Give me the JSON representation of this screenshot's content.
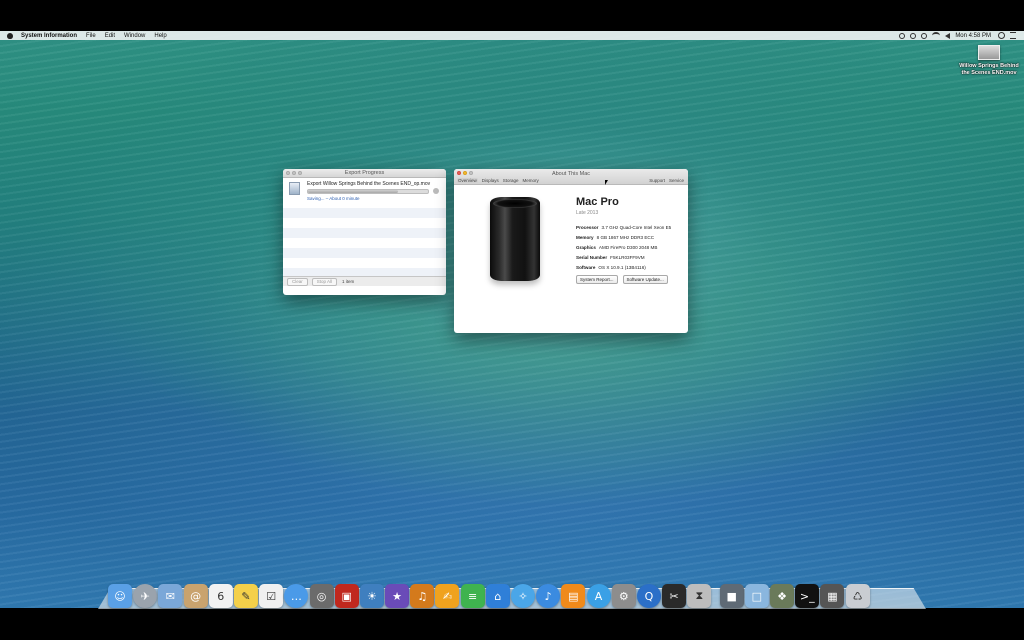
{
  "menubar": {
    "app_name": "System Information",
    "items": [
      "File",
      "Edit",
      "Window",
      "Help"
    ],
    "clock": "Mon 4:58 PM"
  },
  "desktop_file": {
    "label": "Willow Springs Behind the Scenes END.mov"
  },
  "export_window": {
    "title": "Export Progress",
    "job_title": "Export Willow Springs Behind the Scenes END_op.mov",
    "job_status": "Saving... – About 0 minute",
    "progress": 0.75,
    "clear_label": "Clear",
    "stop_label": "Stop All",
    "count": "1 item"
  },
  "about_window": {
    "title": "About This Mac",
    "tabs": [
      "Overview",
      "Displays",
      "Storage",
      "Memory"
    ],
    "right_tabs": [
      "Support",
      "Service"
    ],
    "model": "Mac Pro",
    "year": "Late 2013",
    "specs": [
      {
        "label": "Processor",
        "value": "3.7 GHz Quad-Core Intel Xeon E5"
      },
      {
        "label": "Memory",
        "value": "8 GB 1867 MHz DDR3 ECC"
      },
      {
        "label": "Graphics",
        "value": "AMD FirePro D300 2048 MB"
      },
      {
        "label": "Serial Number",
        "value": "F5KLR03FF9VM"
      },
      {
        "label": "Software",
        "value": "OS X 10.9.1 (13B4116)"
      }
    ],
    "system_report_label": "System Report...",
    "software_update_label": "Software Update..."
  },
  "dock": {
    "icons": [
      {
        "name": "finder-icon",
        "color": "#5aa0e6",
        "glyph": "☺"
      },
      {
        "name": "launchpad-icon",
        "color": "#9aa3ad",
        "glyph": "✈"
      },
      {
        "name": "mail-icon",
        "color": "#7aa7d8",
        "glyph": "✉"
      },
      {
        "name": "contacts-icon",
        "color": "#c9a36e",
        "glyph": "@"
      },
      {
        "name": "calendar-icon",
        "color": "#f2f2f2",
        "glyph": "6"
      },
      {
        "name": "notes-icon",
        "color": "#f4d04a",
        "glyph": "✎"
      },
      {
        "name": "reminders-icon",
        "color": "#f0f0f0",
        "glyph": "☑"
      },
      {
        "name": "messages-icon",
        "color": "#4a9ae8",
        "glyph": "…"
      },
      {
        "name": "facetime-icon",
        "color": "#6b6b6b",
        "glyph": "◎"
      },
      {
        "name": "photo-booth-icon",
        "color": "#c0281e",
        "glyph": "▣"
      },
      {
        "name": "iphoto-icon",
        "color": "#3f7fbf",
        "glyph": "☀"
      },
      {
        "name": "imovie-icon",
        "color": "#6a4bb8",
        "glyph": "★"
      },
      {
        "name": "garageband-icon",
        "color": "#d47a1c",
        "glyph": "♫"
      },
      {
        "name": "pages-icon",
        "color": "#f0a21e",
        "glyph": "✍"
      },
      {
        "name": "numbers-icon",
        "color": "#3fb34f",
        "glyph": "≡"
      },
      {
        "name": "keynote-icon",
        "color": "#2f7fd8",
        "glyph": "⌂"
      },
      {
        "name": "safari-icon",
        "color": "#4aa6e8",
        "glyph": "✧"
      },
      {
        "name": "itunes-icon",
        "color": "#3b8be0",
        "glyph": "♪"
      },
      {
        "name": "ibooks-icon",
        "color": "#f08a1a",
        "glyph": "▤"
      },
      {
        "name": "app-store-icon",
        "color": "#3aa0e6",
        "glyph": "A"
      },
      {
        "name": "system-preferences-icon",
        "color": "#8d8d8d",
        "glyph": "⚙"
      },
      {
        "name": "quicktime-icon",
        "color": "#2b6fc8",
        "glyph": "Q"
      },
      {
        "name": "final-cut-pro-icon",
        "color": "#2a2a2a",
        "glyph": "✂"
      },
      {
        "name": "compressor-icon",
        "color": "#bdbdbd",
        "glyph": "⧗"
      },
      {
        "name": "separator",
        "color": "transparent",
        "glyph": ""
      },
      {
        "name": "applications-folder-icon",
        "color": "#5f6a75",
        "glyph": "■"
      },
      {
        "name": "documents-folder-icon",
        "color": "#8ab6de",
        "glyph": "□"
      },
      {
        "name": "stack-icon",
        "color": "#6a7a5a",
        "glyph": "❖"
      },
      {
        "name": "terminal-icon",
        "color": "#111111",
        "glyph": ">_"
      },
      {
        "name": "downloads-stack-icon",
        "color": "#555555",
        "glyph": "▦"
      },
      {
        "name": "trash-icon",
        "color": "#c9cdd2",
        "glyph": "♺"
      }
    ]
  }
}
